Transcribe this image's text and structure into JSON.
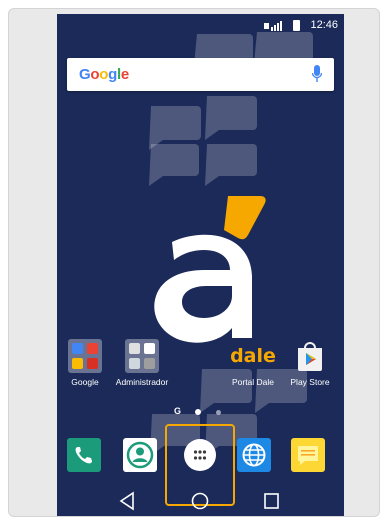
{
  "status_bar": {
    "time": "12:46"
  },
  "search_bar": {
    "logo_letters": [
      {
        "char": "G",
        "color": "#4285F4"
      },
      {
        "char": "o",
        "color": "#EA4335"
      },
      {
        "char": "o",
        "color": "#FBBC05"
      },
      {
        "char": "g",
        "color": "#4285F4"
      },
      {
        "char": "l",
        "color": "#34A853"
      },
      {
        "char": "e",
        "color": "#EA4335"
      }
    ]
  },
  "home_apps": {
    "google": {
      "label": "Google"
    },
    "administrador": {
      "label": "Administrador"
    },
    "dale": {
      "brand_text": "dale",
      "label": "Portal Dale"
    },
    "play_store": {
      "label": "Play Store"
    }
  },
  "page_indicator": {
    "g_mark": "G",
    "pages": 3,
    "current": 1
  },
  "dock": {
    "icons": [
      "phone-icon",
      "contacts-icon",
      "app-drawer-icon",
      "browser-icon",
      "messages-icon"
    ]
  },
  "nav": {
    "buttons": [
      "back-icon",
      "home-icon",
      "recents-icon"
    ]
  },
  "colors": {
    "wallpaper": "#1b2a58",
    "accent_orange": "#f7a800",
    "phone_green": "#1b9b7a",
    "browser_blue": "#1e88e5",
    "messages_yellow": "#fdd835"
  }
}
